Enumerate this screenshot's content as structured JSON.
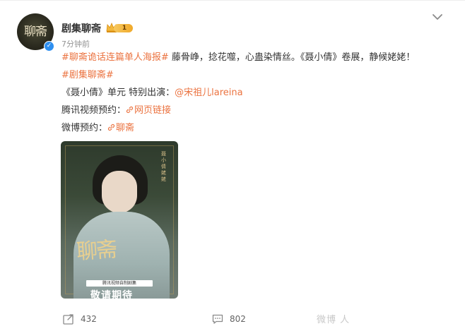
{
  "author": {
    "name": "剧集聊斋",
    "avatar_text": "聊斋",
    "badge_level": "1",
    "time": "7分钟前"
  },
  "post": {
    "line1_topic": "#聊斋诡话连篇单人海报#",
    "line1_text": " 藤骨峥，捻花噬，心蛊染情丝。《聂小倩》卷展，静候姥姥！",
    "line2_topic": "#剧集聊斋#",
    "line3_prefix": "《聂小倩》单元 特别出演：",
    "line3_mention": "@宋祖儿lareina",
    "line4_prefix": "腾讯视频预约：",
    "line4_link": "网页链接",
    "line5_prefix": "微博预约：",
    "line5_link": "聊斋"
  },
  "poster": {
    "side_text": "聂小倩 姥姥",
    "logo_text": "聊斋",
    "subtitle": "腾讯视频自制剧集",
    "bottom_text": "敬请期待"
  },
  "actions": {
    "repost_count": "432",
    "comment_count": "802",
    "like_count": ""
  },
  "watermark": "微博 人",
  "colors": {
    "accent": "#eb7340",
    "verified": "#2e8ff0",
    "muted": "#939393"
  }
}
